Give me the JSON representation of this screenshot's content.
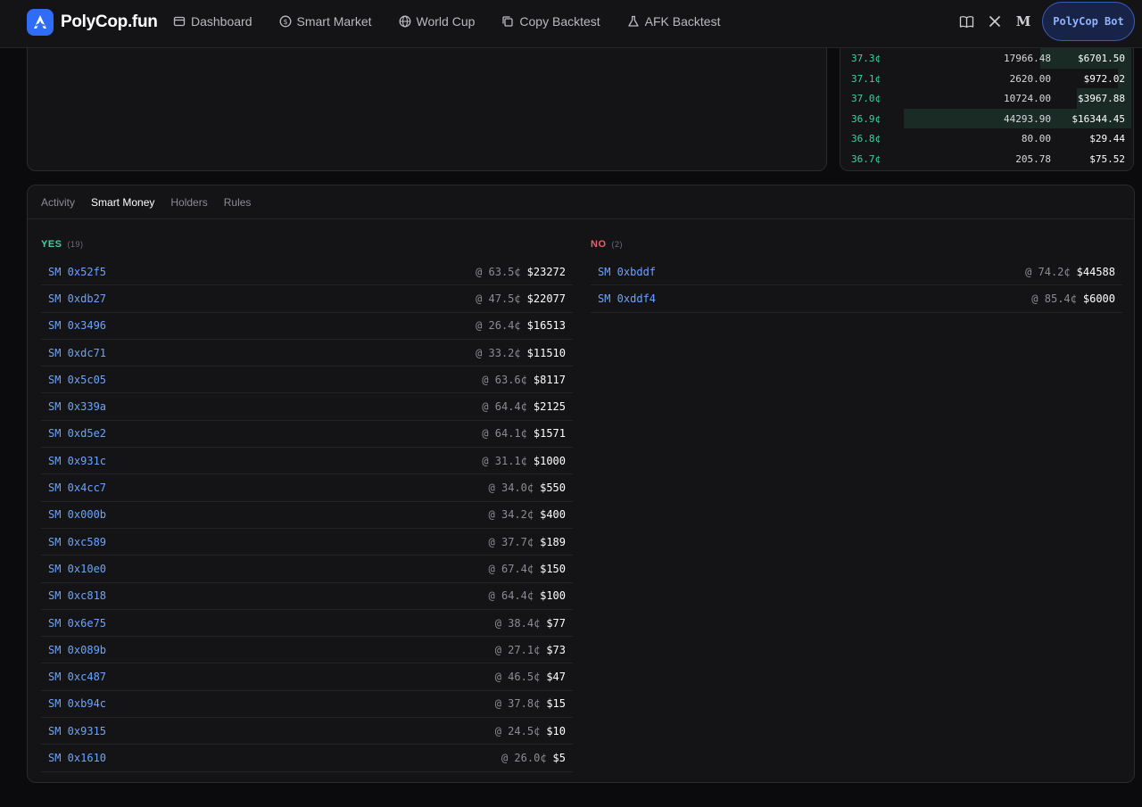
{
  "header": {
    "logo_text": "PolyCop.fun",
    "nav": [
      {
        "label": "Dashboard",
        "icon": "window-icon"
      },
      {
        "label": "Smart Market",
        "icon": "dollar-circle-icon"
      },
      {
        "label": "World Cup",
        "icon": "globe-icon"
      },
      {
        "label": "Copy Backtest",
        "icon": "copy-icon"
      },
      {
        "label": "AFK Backtest",
        "icon": "flask-icon"
      }
    ],
    "right_icons": [
      "book-icon",
      "x-logo-icon",
      "medium-logo-icon"
    ],
    "medium_glyph": "M",
    "bot_button": "PolyCop Bot"
  },
  "orderbook": [
    {
      "price": "37.3¢",
      "shares": "17966.48",
      "total": "$6701.50",
      "depth": 0.4
    },
    {
      "price": "37.1¢",
      "shares": "2620.00",
      "total": "$972.02",
      "depth": 0.06
    },
    {
      "price": "37.0¢",
      "shares": "10724.00",
      "total": "$3967.88",
      "depth": 0.24
    },
    {
      "price": "36.9¢",
      "shares": "44293.90",
      "total": "$16344.45",
      "depth": 1.0
    },
    {
      "price": "36.8¢",
      "shares": "80.00",
      "total": "$29.44",
      "depth": 0.0
    },
    {
      "price": "36.7¢",
      "shares": "205.78",
      "total": "$75.52",
      "depth": 0.0
    }
  ],
  "tabs": [
    {
      "label": "Activity",
      "active": false
    },
    {
      "label": "Smart Money",
      "active": true
    },
    {
      "label": "Holders",
      "active": false
    },
    {
      "label": "Rules",
      "active": false
    }
  ],
  "yes": {
    "label": "YES",
    "count": "(19)",
    "rows": [
      {
        "addr": "SM 0x52f5",
        "price": "@ 63.5¢",
        "amount": "$23272"
      },
      {
        "addr": "SM 0xdb27",
        "price": "@ 47.5¢",
        "amount": "$22077"
      },
      {
        "addr": "SM 0x3496",
        "price": "@ 26.4¢",
        "amount": "$16513"
      },
      {
        "addr": "SM 0xdc71",
        "price": "@ 33.2¢",
        "amount": "$11510"
      },
      {
        "addr": "SM 0x5c05",
        "price": "@ 63.6¢",
        "amount": "$8117"
      },
      {
        "addr": "SM 0x339a",
        "price": "@ 64.4¢",
        "amount": "$2125"
      },
      {
        "addr": "SM 0xd5e2",
        "price": "@ 64.1¢",
        "amount": "$1571"
      },
      {
        "addr": "SM 0x931c",
        "price": "@ 31.1¢",
        "amount": "$1000"
      },
      {
        "addr": "SM 0x4cc7",
        "price": "@ 34.0¢",
        "amount": "$550"
      },
      {
        "addr": "SM 0x000b",
        "price": "@ 34.2¢",
        "amount": "$400"
      },
      {
        "addr": "SM 0xc589",
        "price": "@ 37.7¢",
        "amount": "$189"
      },
      {
        "addr": "SM 0x10e0",
        "price": "@ 67.4¢",
        "amount": "$150"
      },
      {
        "addr": "SM 0xc818",
        "price": "@ 64.4¢",
        "amount": "$100"
      },
      {
        "addr": "SM 0x6e75",
        "price": "@ 38.4¢",
        "amount": "$77"
      },
      {
        "addr": "SM 0x089b",
        "price": "@ 27.1¢",
        "amount": "$73"
      },
      {
        "addr": "SM 0xc487",
        "price": "@ 46.5¢",
        "amount": "$47"
      },
      {
        "addr": "SM 0xb94c",
        "price": "@ 37.8¢",
        "amount": "$15"
      },
      {
        "addr": "SM 0x9315",
        "price": "@ 24.5¢",
        "amount": "$10"
      },
      {
        "addr": "SM 0x1610",
        "price": "@ 26.0¢",
        "amount": "$5"
      }
    ]
  },
  "no": {
    "label": "NO",
    "count": "(2)",
    "rows": [
      {
        "addr": "SM 0xbddf",
        "price": "@ 74.2¢",
        "amount": "$44588"
      },
      {
        "addr": "SM 0xddf4",
        "price": "@ 85.4¢",
        "amount": "$6000"
      }
    ]
  },
  "colors": {
    "accent": "#2f6df6",
    "yes": "#3ad29f",
    "no": "#ef5d6c",
    "address": "#6aa4ff"
  }
}
